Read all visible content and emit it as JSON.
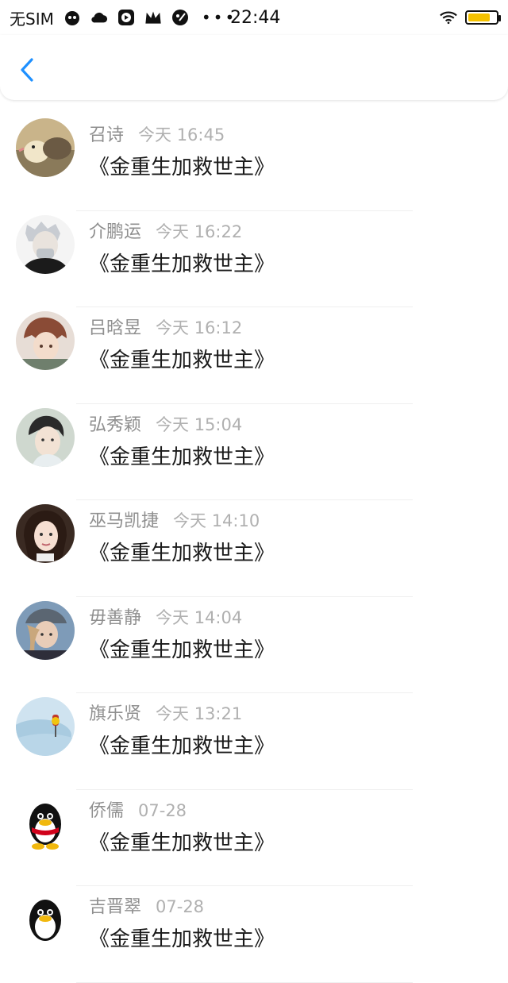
{
  "status_bar": {
    "carrier": "无SIM",
    "time": "22:44",
    "icons": [
      "cat-face-icon",
      "cloud-icon",
      "play-button-icon",
      "crown-icon",
      "palette-icon"
    ],
    "more": "•••",
    "wifi_icon": "wifi-icon",
    "battery_icon": "battery-icon",
    "battery_color": "#f5c200",
    "battery_level": 0.8
  },
  "nav": {
    "back_icon": "back-chevron-icon",
    "accent": "#1e90ff"
  },
  "items": [
    {
      "name": "召诗",
      "time": "今天 16:45",
      "message": "《金重生加救世主》"
    },
    {
      "name": "介鹏运",
      "time": "今天 16:22",
      "message": "《金重生加救世主》"
    },
    {
      "name": "吕晗昱",
      "time": "今天 16:12",
      "message": "《金重生加救世主》"
    },
    {
      "name": "弘秀颖",
      "time": "今天 15:04",
      "message": "《金重生加救世主》"
    },
    {
      "name": "巫马凯捷",
      "time": "今天 14:10",
      "message": "《金重生加救世主》"
    },
    {
      "name": "毋善静",
      "time": "今天 14:04",
      "message": "《金重生加救世主》"
    },
    {
      "name": "旗乐贤",
      "time": "今天 13:21",
      "message": "《金重生加救世主》"
    },
    {
      "name": "侨儒",
      "time": "07-28",
      "message": "《金重生加救世主》"
    },
    {
      "name": "吉晋翠",
      "time": "07-28",
      "message": "《金重生加救世主》"
    }
  ]
}
